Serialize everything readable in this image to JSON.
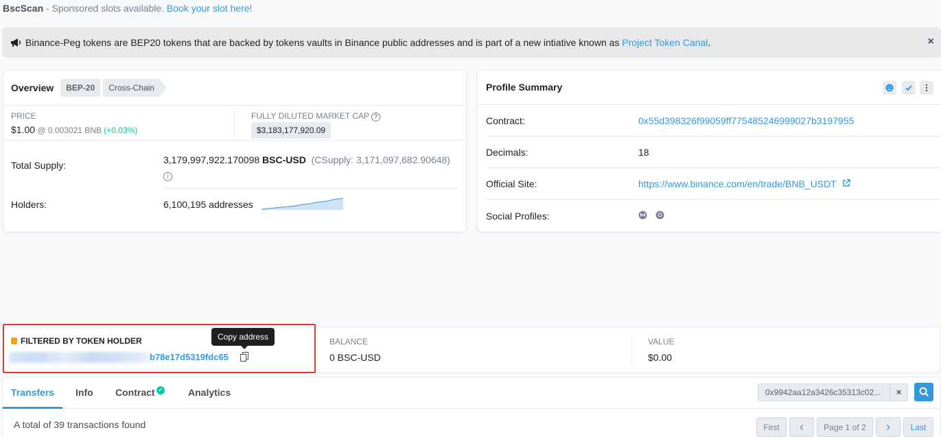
{
  "sponsor": {
    "brand": "BscScan",
    "text": " - Sponsored slots available. ",
    "link": "Book your slot here!"
  },
  "banner": {
    "text": "Binance-Peg tokens are BEP20 tokens that are backed by tokens vaults in Binance public addresses and is part of a new intiative known as ",
    "link": "Project Token Canal",
    "suffix": ".",
    "close": "×"
  },
  "overview": {
    "title": "Overview",
    "tag1": "BEP-20",
    "tag2": "Cross-Chain",
    "price_label": "PRICE",
    "price": "$1.00",
    "price_bnb": " @ 0.003021 BNB ",
    "price_change": "(+0.03%)",
    "mcap_label": "FULLY DILUTED MARKET CAP",
    "mcap_value": "$3,183,177,920.09",
    "supply_label": "Total Supply:",
    "supply_value": "3,179,997,922.170098",
    "supply_symbol": "BSC-USD",
    "csupply": "(CSupply: 3,171,097,682.90648)",
    "holders_label": "Holders:",
    "holders_value": "6,100,195 addresses"
  },
  "profile": {
    "title": "Profile Summary",
    "contract_label": "Contract:",
    "contract_value": "0x55d398326f99059ff775485246999027b3197955",
    "decimals_label": "Decimals:",
    "decimals_value": "18",
    "site_label": "Official Site:",
    "site_value": "https://www.binance.com/en/trade/BNB_USDT",
    "social_label": "Social Profiles:"
  },
  "filter": {
    "title": "FILTERED BY TOKEN HOLDER",
    "address_visible": "b78e17d5319fdc65",
    "tooltip": "Copy address",
    "balance_label": "BALANCE",
    "balance_value": "0 BSC-USD",
    "value_label": "VALUE",
    "value_value": "$0.00"
  },
  "tabs": {
    "transfers": "Transfers",
    "info": "Info",
    "contract": "Contract",
    "analytics": "Analytics"
  },
  "search": {
    "value": "0x9942aa12a3426c35313c02...",
    "clear": "×"
  },
  "results": {
    "summary": "A total of 39 transactions found"
  },
  "pager": {
    "first": "First",
    "prev": "‹",
    "page": "Page 1 of 2",
    "next": "›",
    "last": "Last"
  },
  "colors": {
    "accent": "#3498db",
    "positive": "#00c9a7",
    "highlight_border": "#e53935"
  }
}
